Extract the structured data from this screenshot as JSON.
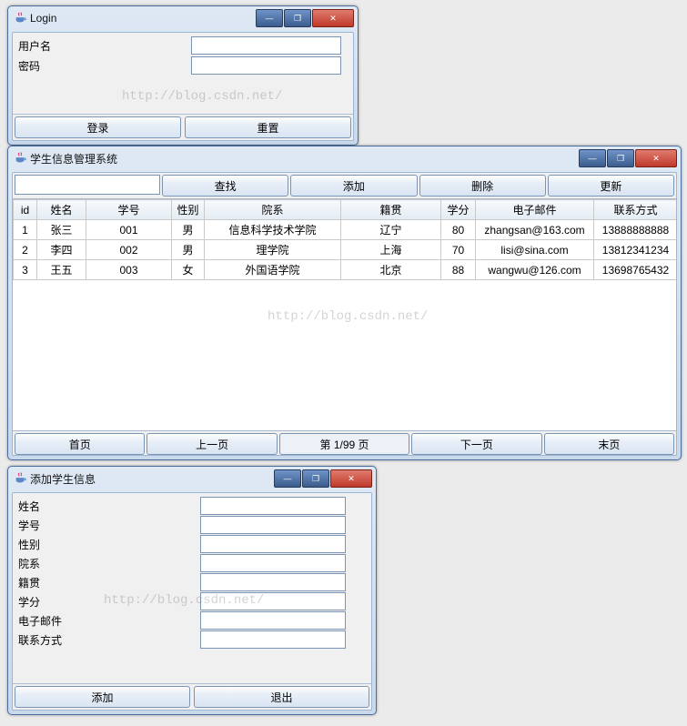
{
  "watermark": "http://blog.csdn.net/",
  "loginWindow": {
    "title": "Login",
    "usernameLabel": "用户名",
    "passwordLabel": "密码",
    "usernameValue": "",
    "passwordValue": "",
    "loginBtn": "登录",
    "resetBtn": "重置"
  },
  "mainWindow": {
    "title": "学生信息管理系统",
    "searchValue": "",
    "toolbar": {
      "searchBtn": "查找",
      "addBtn": "添加",
      "deleteBtn": "删除",
      "updateBtn": "更新"
    },
    "columns": {
      "id": "id",
      "name": "姓名",
      "sno": "学号",
      "gender": "性别",
      "dept": "院系",
      "hometown": "籍贯",
      "credit": "学分",
      "email": "电子邮件",
      "phone": "联系方式"
    },
    "rows": [
      {
        "id": "1",
        "name": "张三",
        "sno": "001",
        "gender": "男",
        "dept": "信息科学技术学院",
        "hometown": "辽宁",
        "credit": "80",
        "email": "zhangsan@163.com",
        "phone": "13888888888"
      },
      {
        "id": "2",
        "name": "李四",
        "sno": "002",
        "gender": "男",
        "dept": "理学院",
        "hometown": "上海",
        "credit": "70",
        "email": "lisi@sina.com",
        "phone": "13812341234"
      },
      {
        "id": "3",
        "name": "王五",
        "sno": "003",
        "gender": "女",
        "dept": "外国语学院",
        "hometown": "北京",
        "credit": "88",
        "email": "wangwu@126.com",
        "phone": "13698765432"
      }
    ],
    "pager": {
      "first": "首页",
      "prev": "上一页",
      "pageLabel": "第 1/99 页",
      "next": "下一页",
      "last": "末页"
    }
  },
  "addWindow": {
    "title": "添加学生信息",
    "fields": {
      "name": "姓名",
      "sno": "学号",
      "gender": "性别",
      "dept": "院系",
      "hometown": "籍贯",
      "credit": "学分",
      "email": "电子邮件",
      "phone": "联系方式"
    },
    "values": {
      "name": "",
      "sno": "",
      "gender": "",
      "dept": "",
      "hometown": "",
      "credit": "",
      "email": "",
      "phone": ""
    },
    "addBtn": "添加",
    "exitBtn": "退出"
  }
}
